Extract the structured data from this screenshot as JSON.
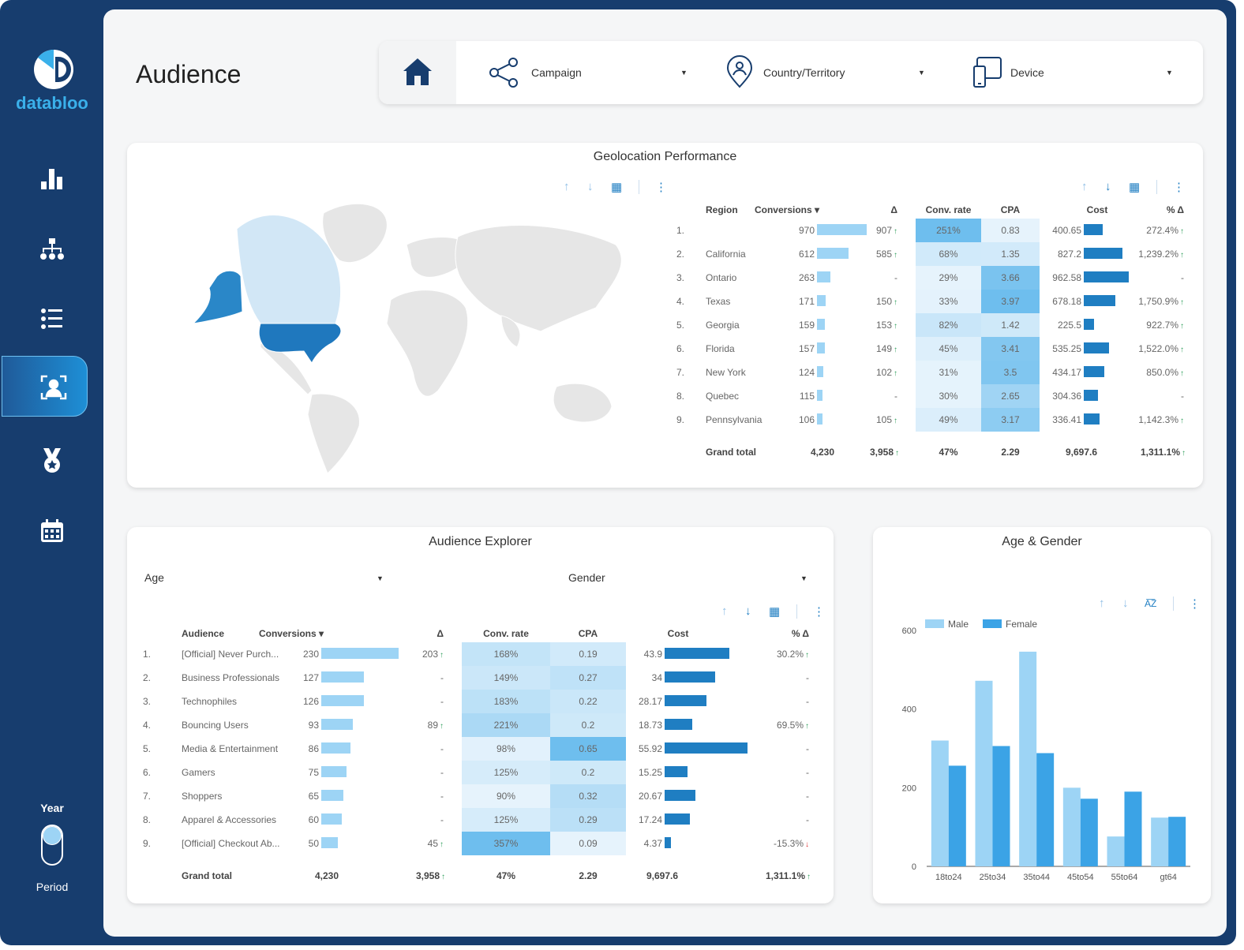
{
  "brand": {
    "name": "databloo"
  },
  "header": {
    "title": "Audience"
  },
  "filters": [
    {
      "label": "Campaign",
      "icon": "share-icon"
    },
    {
      "label": "Country/Territory",
      "icon": "location-person-icon"
    },
    {
      "label": "Device",
      "icon": "devices-icon"
    }
  ],
  "sidebar": {
    "items": [
      {
        "name": "overview",
        "icon": "bar-chart-icon"
      },
      {
        "name": "structure",
        "icon": "hierarchy-icon"
      },
      {
        "name": "list",
        "icon": "list-icon"
      },
      {
        "name": "audience",
        "icon": "audience-icon",
        "active": true
      },
      {
        "name": "awards",
        "icon": "medal-icon"
      },
      {
        "name": "calendar",
        "icon": "calendar-icon"
      }
    ],
    "toggle": {
      "top_label": "Year",
      "bottom_label": "Period",
      "state": "Year"
    }
  },
  "colors": {
    "navy": "#173d6e",
    "accent": "#1f7ec2",
    "light_bar": "#9dd4f5",
    "dark_bar": "#1f7ec2",
    "male": "#9dd4f5",
    "female": "#3ba3e6"
  },
  "geo": {
    "title": "Geolocation Performance",
    "headers": [
      "Region",
      "Conversions ▾",
      "Δ",
      "Conv. rate",
      "CPA",
      "Cost",
      "% Δ"
    ],
    "rows": [
      {
        "rank": "1.",
        "region": "",
        "conv": 970,
        "delta": "907",
        "delta_dir": "up",
        "rate": "251%",
        "cpa": "0.83",
        "cost": 400.65,
        "pct": "272.4%",
        "pct_dir": "up"
      },
      {
        "rank": "2.",
        "region": "California",
        "conv": 612,
        "delta": "585",
        "delta_dir": "up",
        "rate": "68%",
        "cpa": "1.35",
        "cost": 827.2,
        "pct": "1,239.2%",
        "pct_dir": "up"
      },
      {
        "rank": "3.",
        "region": "Ontario",
        "conv": 263,
        "delta": "-",
        "delta_dir": "",
        "rate": "29%",
        "cpa": "3.66",
        "cost": 962.58,
        "pct": "-",
        "pct_dir": ""
      },
      {
        "rank": "4.",
        "region": "Texas",
        "conv": 171,
        "delta": "150",
        "delta_dir": "up",
        "rate": "33%",
        "cpa": "3.97",
        "cost": 678.18,
        "pct": "1,750.9%",
        "pct_dir": "up"
      },
      {
        "rank": "5.",
        "region": "Georgia",
        "conv": 159,
        "delta": "153",
        "delta_dir": "up",
        "rate": "82%",
        "cpa": "1.42",
        "cost": 225.5,
        "pct": "922.7%",
        "pct_dir": "up"
      },
      {
        "rank": "6.",
        "region": "Florida",
        "conv": 157,
        "delta": "149",
        "delta_dir": "up",
        "rate": "45%",
        "cpa": "3.41",
        "cost": 535.25,
        "pct": "1,522.0%",
        "pct_dir": "up"
      },
      {
        "rank": "7.",
        "region": "New York",
        "conv": 124,
        "delta": "102",
        "delta_dir": "up",
        "rate": "31%",
        "cpa": "3.5",
        "cost": 434.17,
        "pct": "850.0%",
        "pct_dir": "up"
      },
      {
        "rank": "8.",
        "region": "Quebec",
        "conv": 115,
        "delta": "-",
        "delta_dir": "",
        "rate": "30%",
        "cpa": "2.65",
        "cost": 304.36,
        "pct": "-",
        "pct_dir": ""
      },
      {
        "rank": "9.",
        "region": "Pennsylvania",
        "conv": 106,
        "delta": "105",
        "delta_dir": "up",
        "rate": "49%",
        "cpa": "3.17",
        "cost": 336.41,
        "pct": "1,142.3%",
        "pct_dir": "up"
      }
    ],
    "total": {
      "label": "Grand total",
      "conv": "4,230",
      "delta": "3,958",
      "delta_dir": "up",
      "rate": "47%",
      "cpa": "2.29",
      "cost": "9,697.6",
      "pct": "1,311.1%",
      "pct_dir": "up"
    }
  },
  "audience": {
    "title": "Audience Explorer",
    "dropdowns": [
      "Age",
      "Gender"
    ],
    "headers": [
      "Audience",
      "Conversions ▾",
      "Δ",
      "Conv. rate",
      "CPA",
      "Cost",
      "% Δ"
    ],
    "rows": [
      {
        "rank": "1.",
        "region": "[Official] Never Purch...",
        "conv": 230,
        "delta": "203",
        "delta_dir": "up",
        "rate": "168%",
        "cpa": "0.19",
        "cost": 43.9,
        "pct": "30.2%",
        "pct_dir": "up"
      },
      {
        "rank": "2.",
        "region": "Business Professionals",
        "conv": 127,
        "delta": "-",
        "delta_dir": "",
        "rate": "149%",
        "cpa": "0.27",
        "cost": 34,
        "pct": "-",
        "pct_dir": ""
      },
      {
        "rank": "3.",
        "region": "Technophiles",
        "conv": 126,
        "delta": "-",
        "delta_dir": "",
        "rate": "183%",
        "cpa": "0.22",
        "cost": 28.17,
        "pct": "-",
        "pct_dir": ""
      },
      {
        "rank": "4.",
        "region": "Bouncing Users",
        "conv": 93,
        "delta": "89",
        "delta_dir": "up",
        "rate": "221%",
        "cpa": "0.2",
        "cost": 18.73,
        "pct": "69.5%",
        "pct_dir": "up"
      },
      {
        "rank": "5.",
        "region": "Media & Entertainment",
        "conv": 86,
        "delta": "-",
        "delta_dir": "",
        "rate": "98%",
        "cpa": "0.65",
        "cost": 55.92,
        "pct": "-",
        "pct_dir": ""
      },
      {
        "rank": "6.",
        "region": "Gamers",
        "conv": 75,
        "delta": "-",
        "delta_dir": "",
        "rate": "125%",
        "cpa": "0.2",
        "cost": 15.25,
        "pct": "-",
        "pct_dir": ""
      },
      {
        "rank": "7.",
        "region": "Shoppers",
        "conv": 65,
        "delta": "-",
        "delta_dir": "",
        "rate": "90%",
        "cpa": "0.32",
        "cost": 20.67,
        "pct": "-",
        "pct_dir": ""
      },
      {
        "rank": "8.",
        "region": "Apparel & Accessories",
        "conv": 60,
        "delta": "-",
        "delta_dir": "",
        "rate": "125%",
        "cpa": "0.29",
        "cost": 17.24,
        "pct": "-",
        "pct_dir": ""
      },
      {
        "rank": "9.",
        "region": "[Official] Checkout Ab...",
        "conv": 50,
        "delta": "45",
        "delta_dir": "up",
        "rate": "357%",
        "cpa": "0.09",
        "cost": 4.37,
        "pct": "-15.3%",
        "pct_dir": "down"
      }
    ],
    "total": {
      "label": "Grand total",
      "conv": "4,230",
      "delta": "3,958",
      "delta_dir": "up",
      "rate": "47%",
      "cpa": "2.29",
      "cost": "9,697.6",
      "pct": "1,311.1%",
      "pct_dir": "up"
    }
  },
  "chart_data": {
    "type": "bar",
    "title": "Age & Gender",
    "categories": [
      "18to24",
      "25to34",
      "35to44",
      "45to54",
      "55to64",
      "gt64"
    ],
    "series": [
      {
        "name": "Male",
        "values": [
          320,
          472,
          546,
          200,
          76,
          124
        ]
      },
      {
        "name": "Female",
        "values": [
          256,
          306,
          288,
          172,
          190,
          126
        ]
      }
    ],
    "ylim": [
      0,
      600
    ],
    "yticks": [
      "0",
      "200",
      "400",
      "600"
    ],
    "legend": "top-left",
    "grid": false
  }
}
